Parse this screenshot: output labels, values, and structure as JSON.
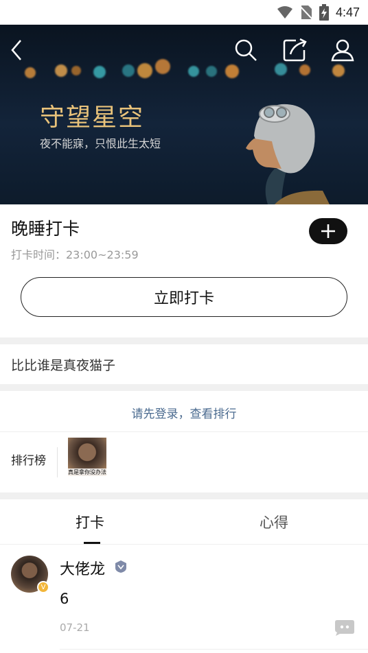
{
  "status_bar": {
    "time": "4:47"
  },
  "hero": {
    "title": "守望星空",
    "subtitle": "夜不能寐，只恨此生太短"
  },
  "checkin": {
    "title": "晚睡打卡",
    "time_label": "打卡时间：23:00~23:59",
    "button_label": "立即打卡"
  },
  "description": "比比谁是真夜猫子",
  "login_prompt": "请先登录，查看排行",
  "ranking": {
    "label": "排行榜",
    "avatar_caption": "真是拿你没办法"
  },
  "tabs": [
    {
      "label": "打卡"
    },
    {
      "label": "心得"
    }
  ],
  "post": {
    "name": "大佬龙",
    "content": "6",
    "date": "07-21",
    "verified_mark": "V"
  }
}
